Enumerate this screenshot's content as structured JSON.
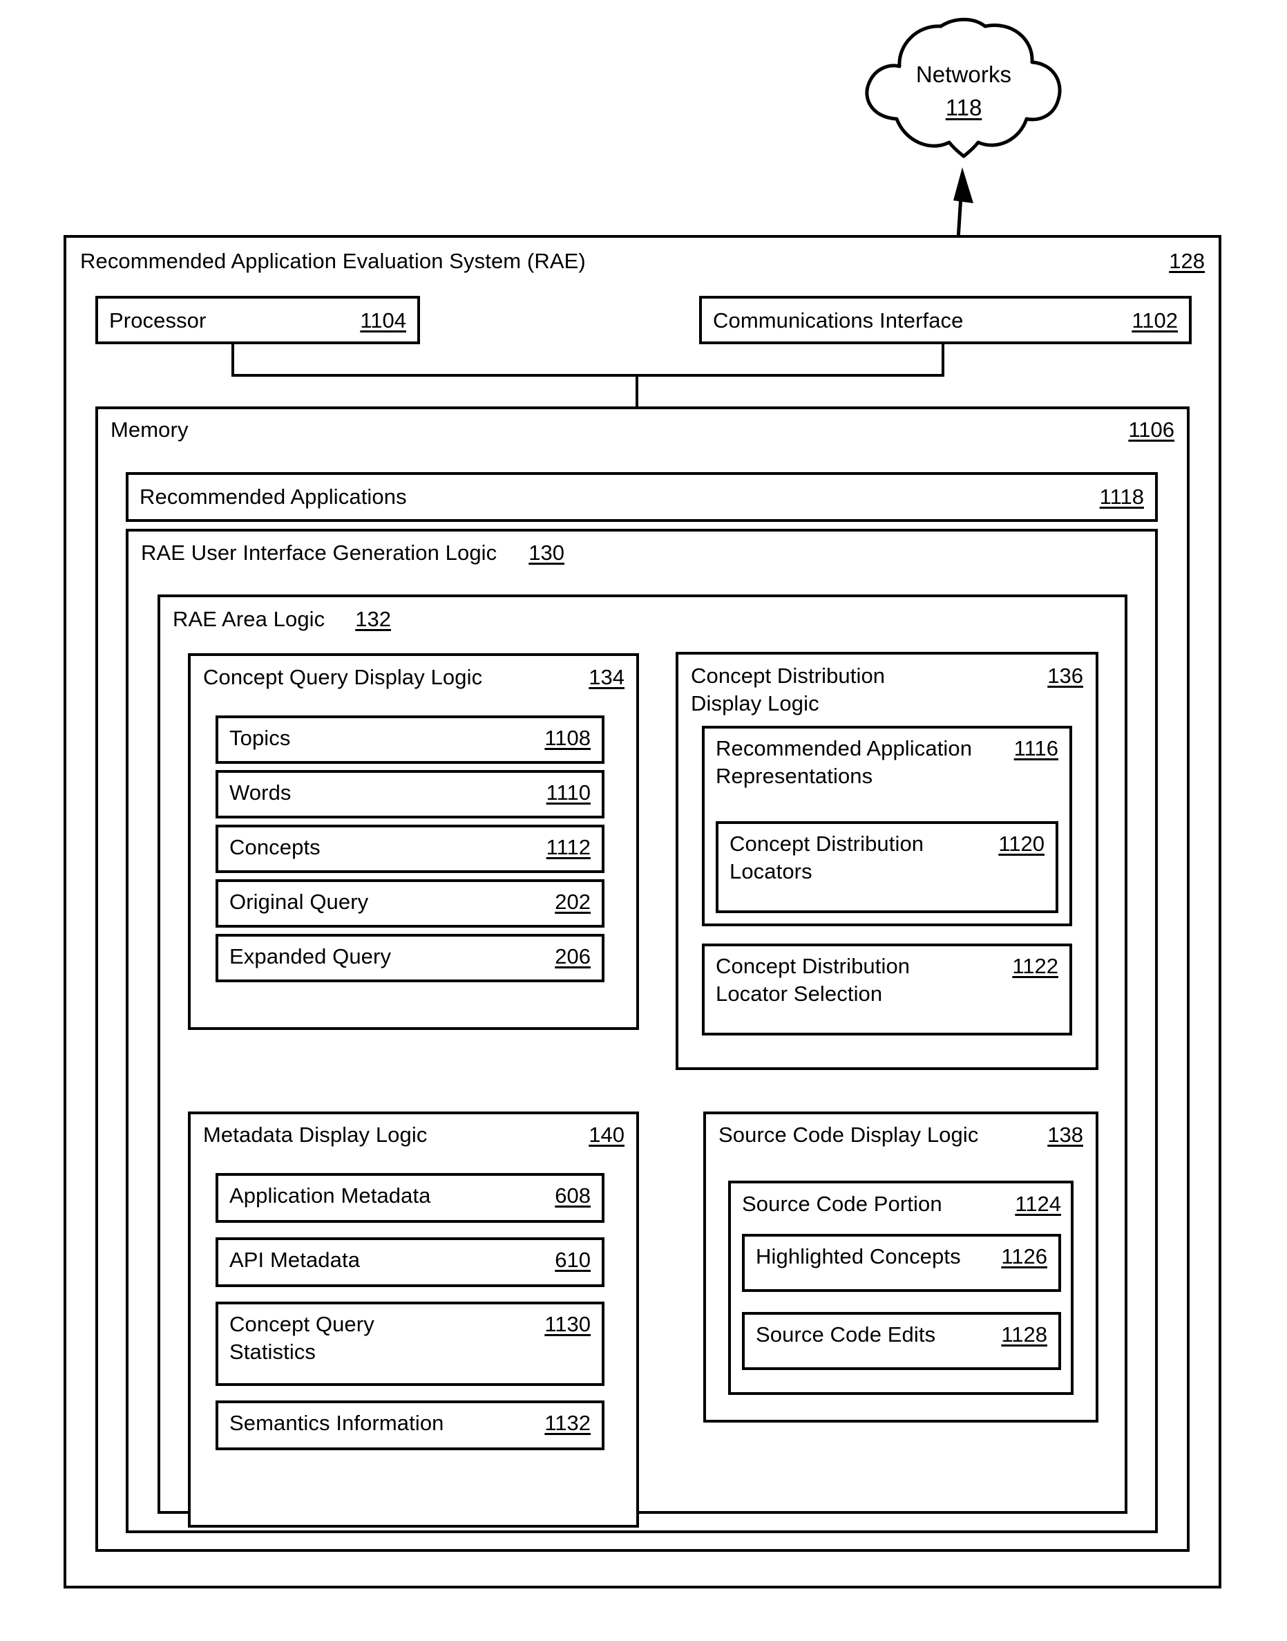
{
  "figure": {
    "network_cloud": {
      "label": "Networks",
      "ref": "118"
    },
    "system": {
      "title": "Recommended Application Evaluation System (RAE)",
      "ref": "128",
      "processor": {
        "label": "Processor",
        "ref": "1104"
      },
      "communications_interface": {
        "label": "Communications Interface",
        "ref": "1102"
      },
      "memory": {
        "label": "Memory",
        "ref": "1106",
        "recommended_applications": {
          "label": "Recommended Applications",
          "ref": "1118"
        },
        "ui_generation_logic": {
          "label": "RAE User Interface Generation Logic",
          "ref": "130",
          "area_logic": {
            "label": "RAE Area Logic",
            "ref": "132",
            "concept_query_display_logic": {
              "label": "Concept Query Display Logic",
              "ref": "134",
              "items": [
                {
                  "label": "Topics",
                  "ref": "1108"
                },
                {
                  "label": "Words",
                  "ref": "1110"
                },
                {
                  "label": "Concepts",
                  "ref": "1112"
                },
                {
                  "label": "Original Query",
                  "ref": "202"
                },
                {
                  "label": "Expanded Query",
                  "ref": "206"
                }
              ]
            },
            "concept_distribution_display_logic": {
              "label": "Concept Distribution Display Logic",
              "ref": "136",
              "recommended_application_representations": {
                "label": "Recommended Application Representations",
                "ref": "1116",
                "concept_distribution_locators": {
                  "label": "Concept Distribution Locators",
                  "ref": "1120"
                }
              },
              "concept_distribution_locator_selection": {
                "label": "Concept Distribution Locator Selection",
                "ref": "1122"
              }
            },
            "metadata_display_logic": {
              "label": "Metadata Display Logic",
              "ref": "140",
              "items": [
                {
                  "label": "Application Metadata",
                  "ref": "608"
                },
                {
                  "label": "API Metadata",
                  "ref": "610"
                },
                {
                  "label": "Concept Query Statistics",
                  "ref": "1130"
                },
                {
                  "label": "Semantics Information",
                  "ref": "1132"
                }
              ]
            },
            "source_code_display_logic": {
              "label": "Source Code Display Logic",
              "ref": "138",
              "source_code_portion": {
                "label": "Source Code Portion",
                "ref": "1124",
                "items": [
                  {
                    "label": "Highlighted Concepts",
                    "ref": "1126"
                  },
                  {
                    "label": "Source Code Edits",
                    "ref": "1128"
                  }
                ]
              }
            }
          }
        }
      }
    }
  }
}
